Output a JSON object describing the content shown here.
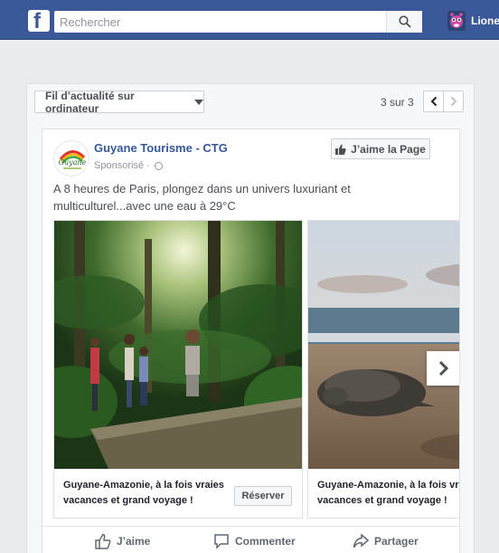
{
  "header": {
    "logo": "f",
    "search_placeholder": "Rechercher",
    "user_name": "Lionel"
  },
  "feed_bar": {
    "selector_label": "Fil d’actualité sur ordinateur",
    "pager_text": "3 sur 3"
  },
  "post": {
    "page_name": "Guyane Tourisme - CTG",
    "sponsored_label": "Sponsorisé ·",
    "like_page_label": "J’aime la Page",
    "text": "A 8 heures de Paris, plongez dans un univers luxuriant et multiculturel...avec une eau à 29°C",
    "carousel": [
      {
        "caption": "Guyane-Amazonie, à la fois vraies vacances et grand voyage !",
        "button": "Réserver"
      },
      {
        "caption": "Guyane-Amazonie, à la fois vraies vacances et grand voyage !"
      }
    ],
    "actions": {
      "like": "J’aime",
      "comment": "Commenter",
      "share": "Partager"
    }
  },
  "colors": {
    "facebook_blue": "#3b5998",
    "link_blue": "#365899",
    "background": "#e9ebee"
  }
}
